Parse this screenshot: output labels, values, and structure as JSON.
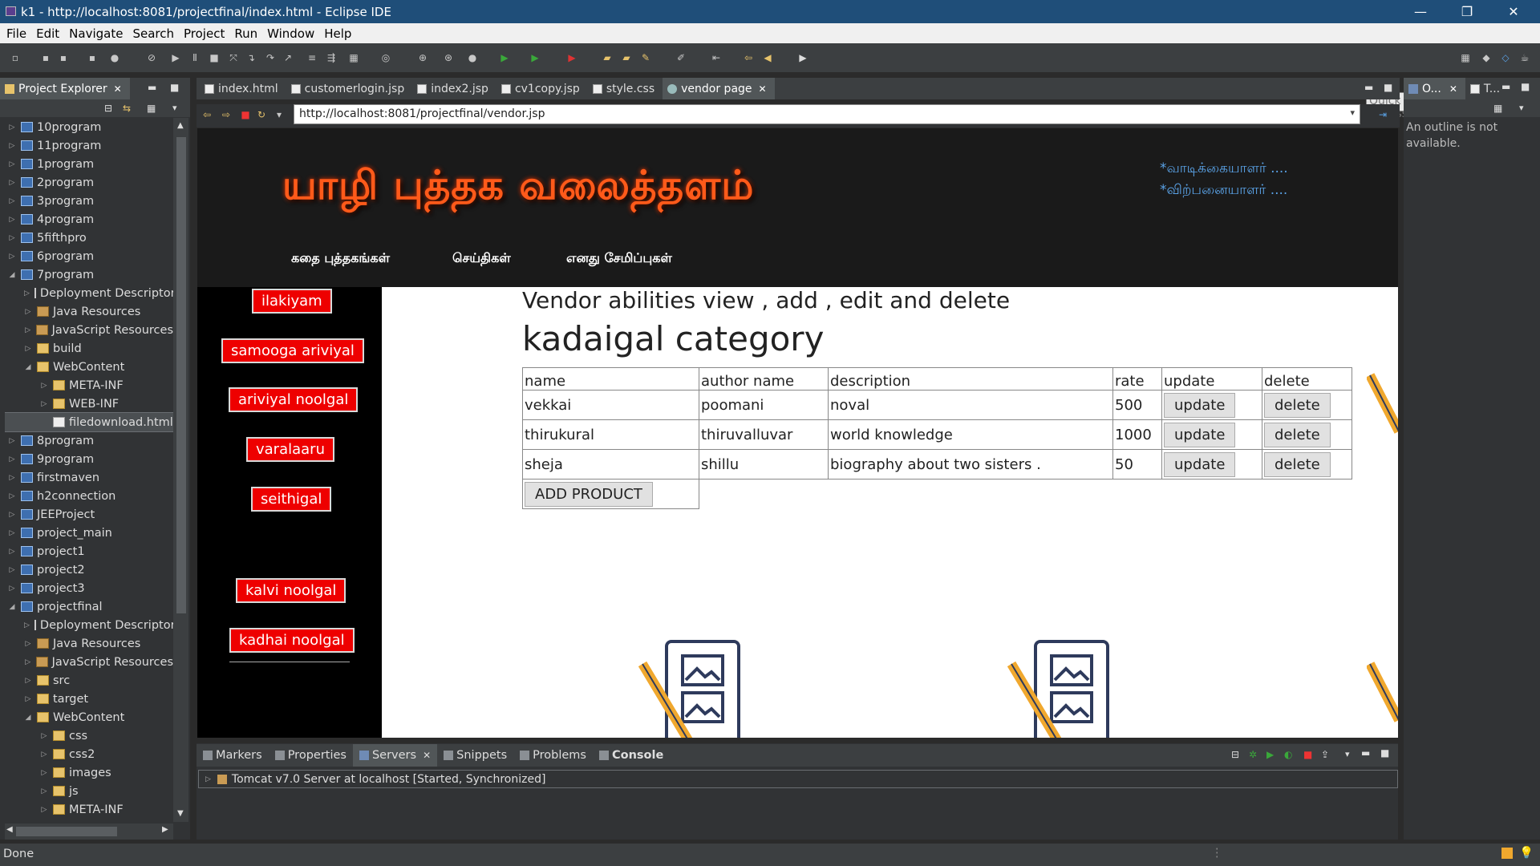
{
  "window": {
    "title": "k1 - http://localhost:8081/projectfinal/index.html - Eclipse IDE",
    "minimize": "—",
    "restore": "❐",
    "close": "✕"
  },
  "menu": [
    "File",
    "Edit",
    "Navigate",
    "Search",
    "Project",
    "Run",
    "Window",
    "Help"
  ],
  "quick_access": "Quick Access",
  "project_explorer": {
    "title": "Project Explorer",
    "items": [
      {
        "label": "10program",
        "depth": 0,
        "type": "proj",
        "exp": "▷"
      },
      {
        "label": "11program",
        "depth": 0,
        "type": "proj",
        "exp": "▷"
      },
      {
        "label": "1program",
        "depth": 0,
        "type": "proj",
        "exp": "▷"
      },
      {
        "label": "2program",
        "depth": 0,
        "type": "proj",
        "exp": "▷"
      },
      {
        "label": "3program",
        "depth": 0,
        "type": "proj",
        "exp": "▷"
      },
      {
        "label": "4program",
        "depth": 0,
        "type": "proj",
        "exp": "▷"
      },
      {
        "label": "5fifthpro",
        "depth": 0,
        "type": "proj",
        "exp": "▷"
      },
      {
        "label": "6program",
        "depth": 0,
        "type": "proj",
        "exp": "▷"
      },
      {
        "label": "7program",
        "depth": 0,
        "type": "proj",
        "exp": "◢"
      },
      {
        "label": "Deployment Descriptor",
        "depth": 1,
        "type": "dd",
        "exp": "▷"
      },
      {
        "label": "Java Resources",
        "depth": 1,
        "type": "jar",
        "exp": "▷"
      },
      {
        "label": "JavaScript Resources",
        "depth": 1,
        "type": "jar",
        "exp": "▷"
      },
      {
        "label": "build",
        "depth": 1,
        "type": "folder",
        "exp": "▷"
      },
      {
        "label": "WebContent",
        "depth": 1,
        "type": "folder",
        "exp": "◢"
      },
      {
        "label": "META-INF",
        "depth": 2,
        "type": "folder",
        "exp": "▷"
      },
      {
        "label": "WEB-INF",
        "depth": 2,
        "type": "folder",
        "exp": "▷"
      },
      {
        "label": "filedownload.html",
        "depth": 2,
        "type": "file",
        "exp": "",
        "sel": true
      },
      {
        "label": "8program",
        "depth": 0,
        "type": "proj",
        "exp": "▷"
      },
      {
        "label": "9program",
        "depth": 0,
        "type": "proj",
        "exp": "▷"
      },
      {
        "label": "firstmaven",
        "depth": 0,
        "type": "proj",
        "exp": "▷"
      },
      {
        "label": "h2connection",
        "depth": 0,
        "type": "proj",
        "exp": "▷"
      },
      {
        "label": "JEEProject",
        "depth": 0,
        "type": "proj",
        "exp": "▷"
      },
      {
        "label": "project_main",
        "depth": 0,
        "type": "proj",
        "exp": "▷"
      },
      {
        "label": "project1",
        "depth": 0,
        "type": "proj",
        "exp": "▷"
      },
      {
        "label": "project2",
        "depth": 0,
        "type": "proj",
        "exp": "▷"
      },
      {
        "label": "project3",
        "depth": 0,
        "type": "proj",
        "exp": "▷"
      },
      {
        "label": "projectfinal",
        "depth": 0,
        "type": "proj",
        "exp": "◢"
      },
      {
        "label": "Deployment Descriptor",
        "depth": 1,
        "type": "dd",
        "exp": "▷"
      },
      {
        "label": "Java Resources",
        "depth": 1,
        "type": "jar",
        "exp": "▷"
      },
      {
        "label": "JavaScript Resources",
        "depth": 1,
        "type": "jar",
        "exp": "▷"
      },
      {
        "label": "src",
        "depth": 1,
        "type": "folder",
        "exp": "▷"
      },
      {
        "label": "target",
        "depth": 1,
        "type": "folder",
        "exp": "▷"
      },
      {
        "label": "WebContent",
        "depth": 1,
        "type": "folder",
        "exp": "◢"
      },
      {
        "label": "css",
        "depth": 2,
        "type": "folder",
        "exp": "▷"
      },
      {
        "label": "css2",
        "depth": 2,
        "type": "folder",
        "exp": "▷"
      },
      {
        "label": "images",
        "depth": 2,
        "type": "folder",
        "exp": "▷"
      },
      {
        "label": "js",
        "depth": 2,
        "type": "folder",
        "exp": "▷"
      },
      {
        "label": "META-INF",
        "depth": 2,
        "type": "folder",
        "exp": "▷"
      }
    ]
  },
  "editor_tabs": [
    "index.html",
    "customerlogin.jsp",
    "index2.jsp",
    "cv1copy.jsp",
    "style.css",
    "vendor page"
  ],
  "url": "http://localhost:8081/projectfinal/vendor.jsp",
  "site": {
    "brand": "யாழி புத்தக வலைத்தளம்",
    "link_reader": "*வாடிக்கையாளர் ....",
    "link_seller": "*விற்பனையாளர் ....",
    "nav": [
      "கதை புத்தகங்கள்",
      "செய்திகள்",
      "எனது சேமிப்புகள்"
    ],
    "sidebar": [
      "ilakiyam",
      "samooga ariviyal",
      "ariviyal noolgal",
      "varalaaru",
      "seithigal",
      "kalvi noolgal",
      "kadhai noolgal"
    ],
    "heading": "Vendor abilities view , add , edit and delete",
    "category": "kadaigal category",
    "table_headers": [
      "name",
      "author name",
      "description",
      "rate",
      "update",
      "delete"
    ],
    "rows": [
      {
        "name": "vekkai",
        "author": "poomani",
        "description": "noval",
        "rate": "500"
      },
      {
        "name": "thirukural",
        "author": "thiruvalluvar",
        "description": "world knowledge",
        "rate": "1000"
      },
      {
        "name": "sheja",
        "author": "shillu",
        "description": "biography about two sisters .",
        "rate": "50"
      }
    ],
    "update_label": "update",
    "delete_label": "delete",
    "add_product": "ADD PRODUCT"
  },
  "bottom_tabs": [
    "Markers",
    "Properties",
    "Servers",
    "Snippets",
    "Problems",
    "Console"
  ],
  "server": "Tomcat v7.0 Server at localhost  [Started, Synchronized]",
  "outline": {
    "tab1": "O...",
    "tab2": "T...",
    "message": "An outline is not available."
  },
  "status": "Done",
  "colors": {
    "accent_red": "#ee0000",
    "brand_orange": "#ff5a1a",
    "link_blue": "#5aa2e6",
    "title_bar": "#1f4e79"
  }
}
